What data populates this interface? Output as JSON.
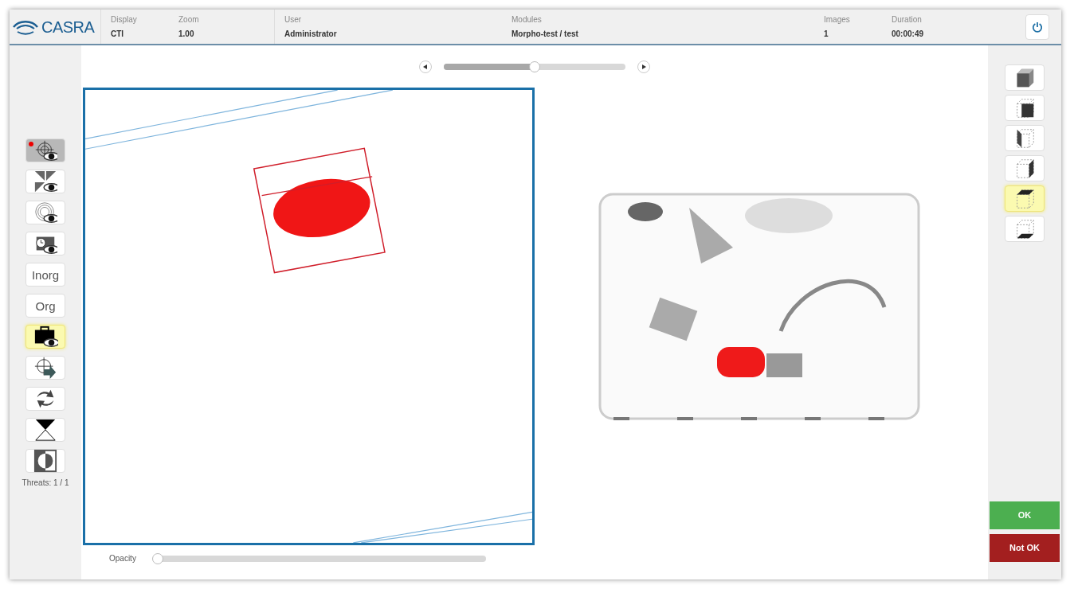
{
  "logo": {
    "text": "CASRA"
  },
  "header_fields": [
    {
      "label": "Display",
      "value": "CTI"
    },
    {
      "label": "Zoom",
      "value": "1.00"
    },
    {
      "label": "User",
      "value": "Administrator"
    },
    {
      "label": "Modules",
      "value": "Morpho-test / test"
    },
    {
      "label": "Images",
      "value": "1"
    },
    {
      "label": "Duration",
      "value": "00:00:49"
    }
  ],
  "tools": [
    {
      "kind": "target",
      "pressed": true,
      "highlighted": false,
      "alert": true
    },
    {
      "kind": "quadrants",
      "pressed": false,
      "highlighted": false,
      "alert": false
    },
    {
      "kind": "rings",
      "pressed": false,
      "highlighted": false,
      "alert": false
    },
    {
      "kind": "clock-case",
      "pressed": false,
      "highlighted": false,
      "alert": false
    },
    {
      "kind": "text",
      "label": "Inorg",
      "pressed": false,
      "highlighted": false,
      "alert": false
    },
    {
      "kind": "text",
      "label": "Org",
      "pressed": false,
      "highlighted": false,
      "alert": false
    },
    {
      "kind": "case",
      "pressed": false,
      "highlighted": true,
      "alert": false
    },
    {
      "kind": "target-arrow",
      "pressed": false,
      "highlighted": false,
      "alert": false
    },
    {
      "kind": "swap",
      "pressed": false,
      "highlighted": false,
      "alert": false
    },
    {
      "kind": "hourglass",
      "pressed": false,
      "highlighted": false,
      "alert": false
    },
    {
      "kind": "contrast",
      "pressed": false,
      "highlighted": false,
      "alert": false
    }
  ],
  "threats": "Threats: 1 / 1",
  "slice_slider": {
    "level": 0.5
  },
  "opacity": {
    "label": "Opacity",
    "level": 0
  },
  "views": [
    {
      "kind": "solid",
      "highlighted": false
    },
    {
      "kind": "front",
      "highlighted": false
    },
    {
      "kind": "left",
      "highlighted": false
    },
    {
      "kind": "right",
      "highlighted": false
    },
    {
      "kind": "top",
      "highlighted": true
    },
    {
      "kind": "bottom",
      "highlighted": false
    }
  ],
  "buttons": [
    {
      "kind": "ok",
      "label": "OK"
    },
    {
      "kind": "not-ok",
      "label": "Not OK"
    }
  ]
}
